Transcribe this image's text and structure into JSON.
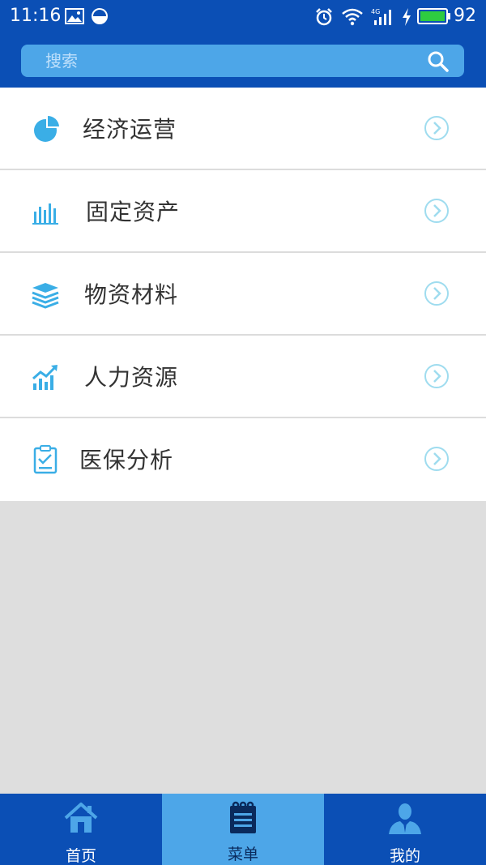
{
  "status_bar": {
    "time": "11:16",
    "battery_percent": "92",
    "network": "4G"
  },
  "search": {
    "placeholder": "搜索"
  },
  "menu": {
    "items": [
      {
        "label": "经济运营",
        "icon": "pie-chart-icon"
      },
      {
        "label": "固定资产",
        "icon": "bar-chart-icon"
      },
      {
        "label": "物资材料",
        "icon": "stack-icon"
      },
      {
        "label": "人力资源",
        "icon": "trend-chart-icon"
      },
      {
        "label": "医保分析",
        "icon": "clipboard-icon"
      }
    ]
  },
  "tabs": [
    {
      "label": "首页",
      "icon": "home-icon",
      "active": false
    },
    {
      "label": "菜单",
      "icon": "notebook-icon",
      "active": true
    },
    {
      "label": "我的",
      "icon": "user-icon",
      "active": false
    }
  ],
  "colors": {
    "primary": "#0b4fb5",
    "accent": "#4da6e8",
    "icon": "#3aaee6",
    "arrow": "#9fdcef",
    "background": "#dedede"
  }
}
